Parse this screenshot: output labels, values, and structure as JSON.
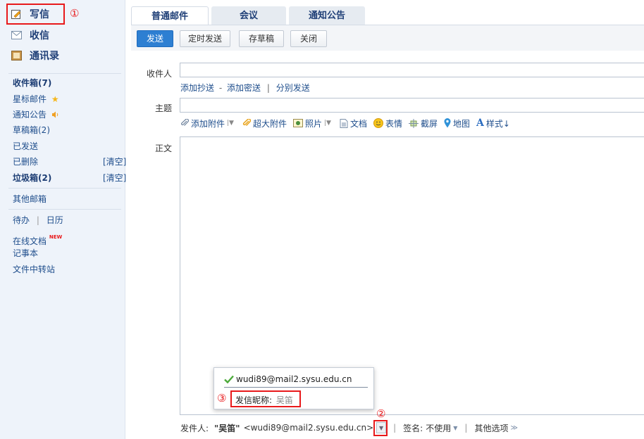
{
  "sidebar": {
    "compose": "写信",
    "inbox": "收信",
    "contacts": "通讯录",
    "folders": [
      {
        "label": "收件箱(7)",
        "bold": true
      },
      {
        "label": "星标邮件",
        "icon": "star-icon"
      },
      {
        "label": "通知公告",
        "icon": "speaker-icon"
      },
      {
        "label": "草稿箱(2)"
      },
      {
        "label": "已发送"
      },
      {
        "label": "已删除",
        "clear": "[清空]"
      },
      {
        "label": "垃圾箱(2)",
        "bold": true,
        "clear": "[清空]"
      }
    ],
    "other_mailbox": "其他邮箱",
    "todo": "待办",
    "calendar": "日历",
    "online_docs": "在线文档",
    "new_badge": "NEW",
    "notepad": "记事本",
    "file_transfer": "文件中转站"
  },
  "annotations": {
    "n1": "①",
    "n2": "②",
    "n3": "③"
  },
  "tabs": [
    "普通邮件",
    "会议",
    "通知公告"
  ],
  "toolbar": {
    "send": "发送",
    "schedule": "定时发送",
    "save_draft": "存草稿",
    "close": "关闭"
  },
  "compose": {
    "to_label": "收件人",
    "add_cc": "添加抄送",
    "dash": "-",
    "add_bcc": "添加密送",
    "pipe": "|",
    "separate": "分别发送",
    "subject_label": "主题",
    "body_label": "正文",
    "insert": {
      "attachment": "添加附件",
      "large_attachment": "超大附件",
      "photo": "照片",
      "document": "文档",
      "emoji": "表情",
      "screenshot": "截屏",
      "map": "地图",
      "style": "样式↓"
    }
  },
  "sender_popup": {
    "email": "wudi89@mail2.sysu.edu.cn",
    "nickname_label": "发信昵称:",
    "nickname_value": "吴笛"
  },
  "footer": {
    "sender_label": "发件人:",
    "sender_name": "\"吴笛\"",
    "sender_email": "<wudi89@mail2.sysu.edu.cn>",
    "signature_label": "签名:",
    "signature_value": "不使用",
    "other_options": "其他选项"
  },
  "colors": {
    "accent": "#2d7fd2",
    "annotation_red": "#e8191b",
    "sidebar_bg": "#eef3fa",
    "link": "#1f4e8c"
  }
}
